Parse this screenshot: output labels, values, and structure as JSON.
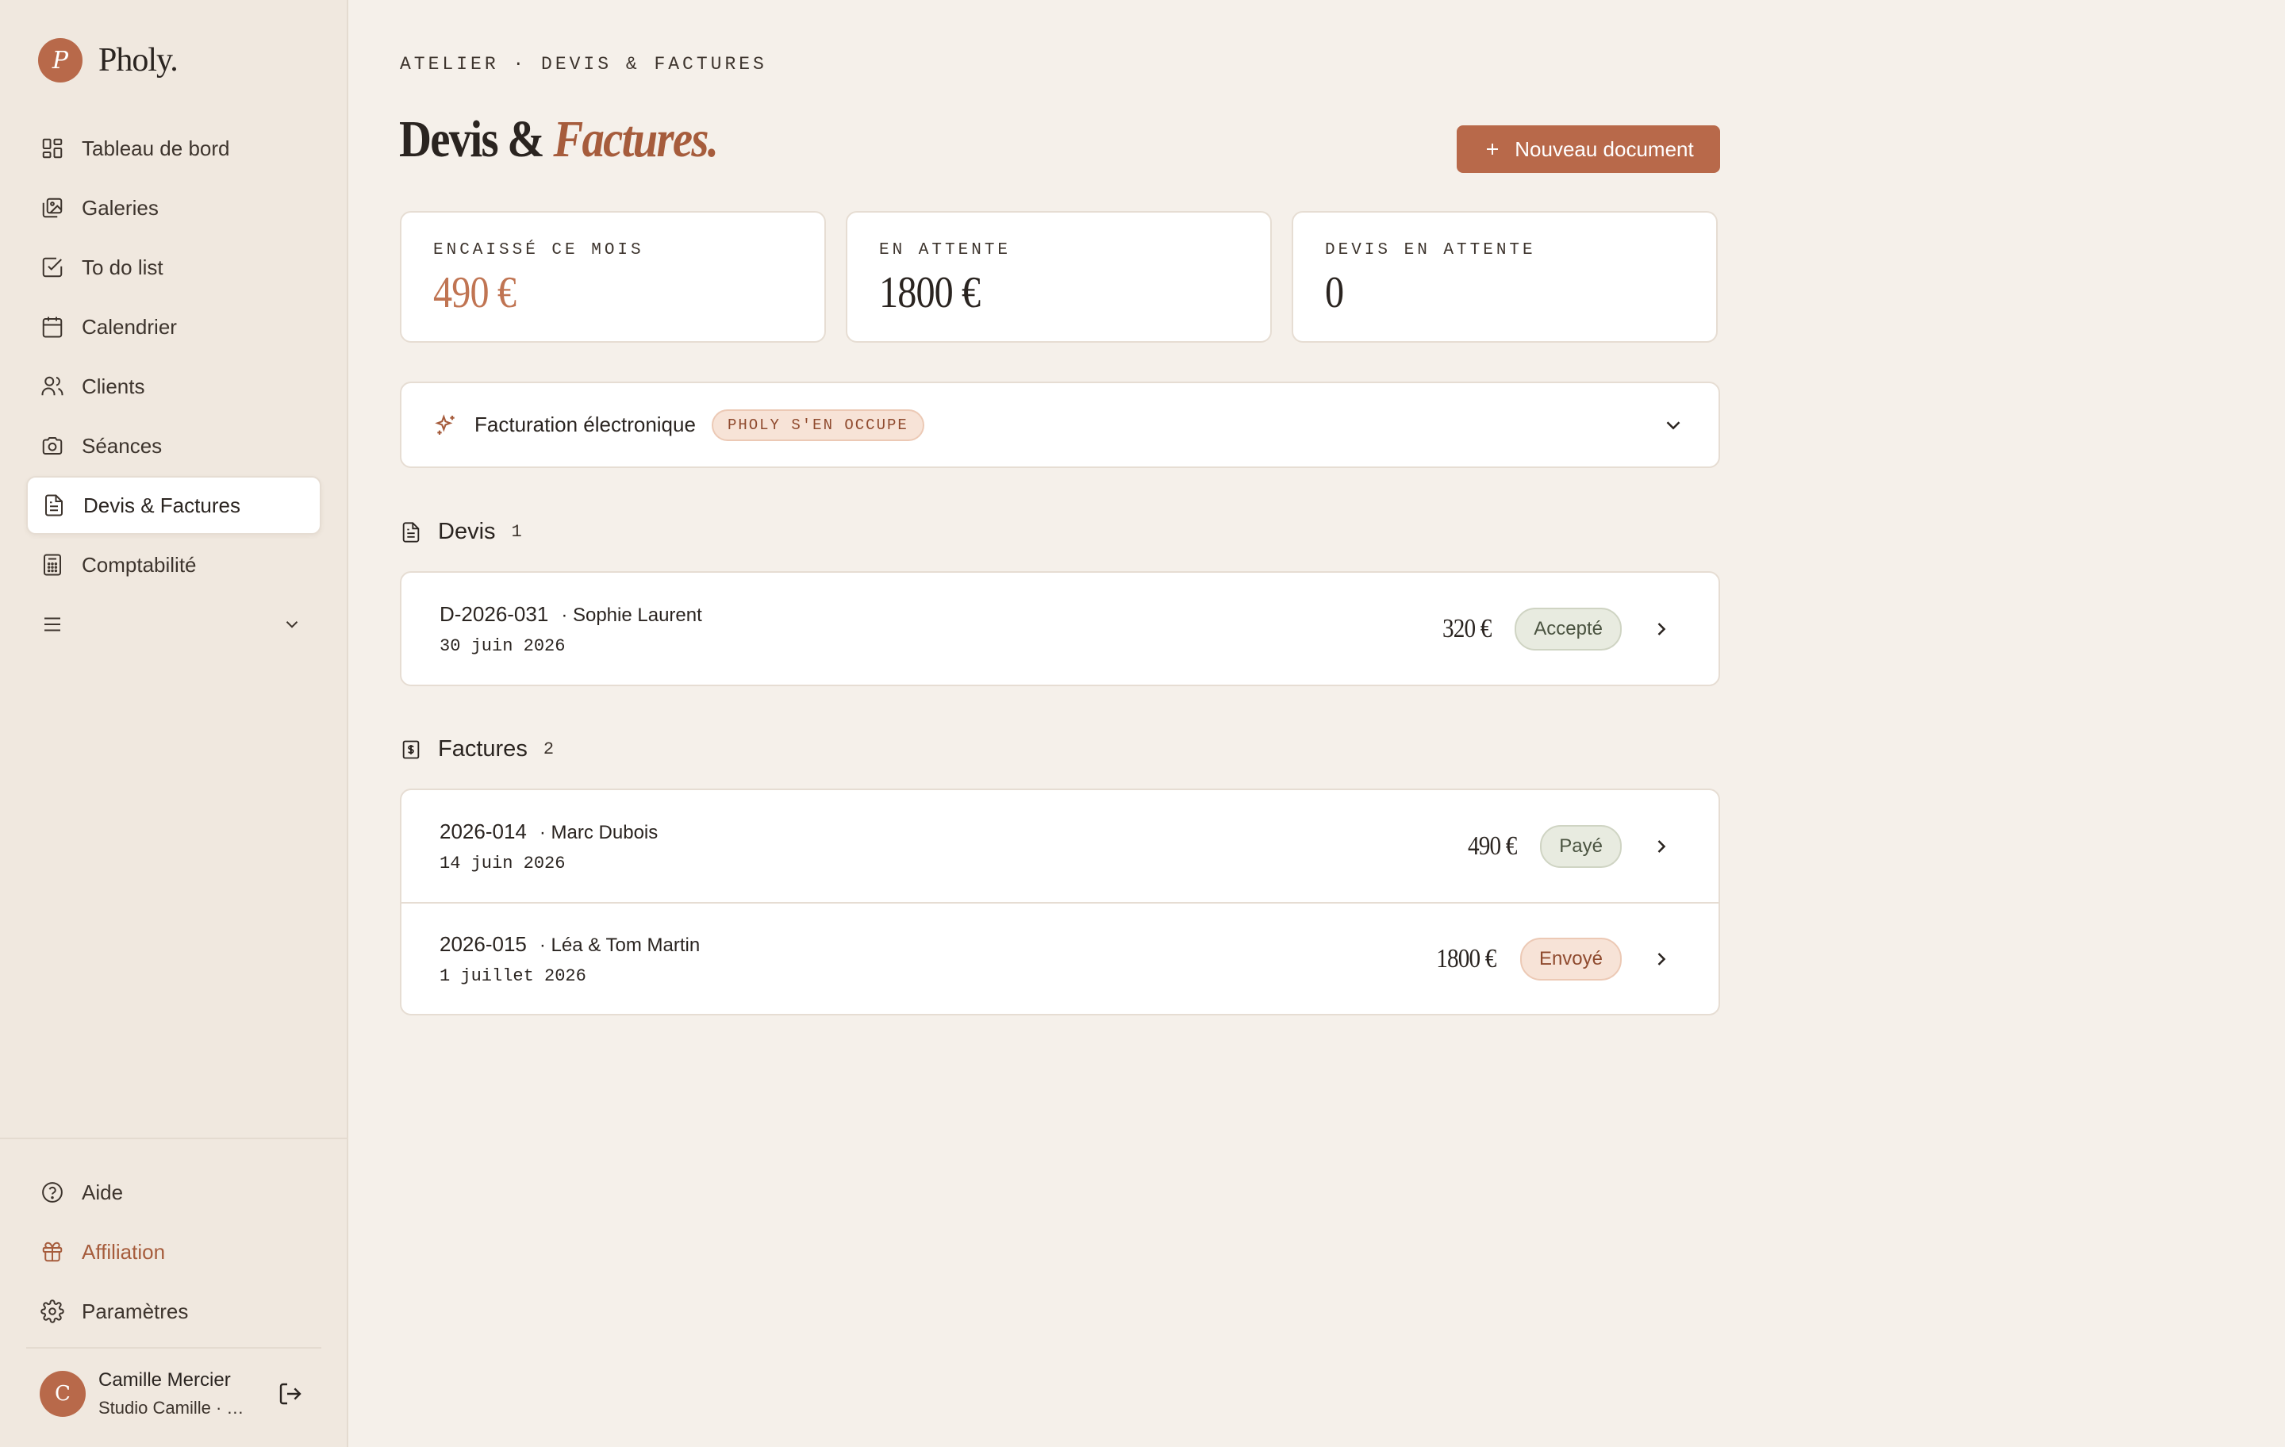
{
  "brand": {
    "mark": "P",
    "name": "Pholy."
  },
  "nav": {
    "items": [
      {
        "label": "Tableau de bord",
        "icon": "dashboard-icon"
      },
      {
        "label": "Galeries",
        "icon": "gallery-icon"
      },
      {
        "label": "To do list",
        "icon": "checkbox-icon"
      },
      {
        "label": "Calendrier",
        "icon": "calendar-icon"
      },
      {
        "label": "Clients",
        "icon": "users-icon"
      },
      {
        "label": "Séances",
        "icon": "camera-icon"
      },
      {
        "label": "Devis & Factures",
        "icon": "document-icon",
        "active": true
      },
      {
        "label": "Comptabilité",
        "icon": "calculator-icon"
      }
    ],
    "more_icon": "menu-icon"
  },
  "bottom_nav": {
    "help": "Aide",
    "affiliation": "Affiliation",
    "settings": "Paramètres"
  },
  "user": {
    "initial": "C",
    "name": "Camille Mercier",
    "studio": "Studio Camille · Photographie"
  },
  "header": {
    "breadcrumb": "ATELIER · DEVIS & FACTURES",
    "title_main": "Devis &",
    "title_accent": "Factures.",
    "new_button": "Nouveau document"
  },
  "stats": [
    {
      "label": "ENCAISSÉ CE MOIS",
      "value": "490 €",
      "accent": true
    },
    {
      "label": "EN ATTENTE",
      "value": "1800 €"
    },
    {
      "label": "DEVIS EN ATTENTE",
      "value": "0"
    }
  ],
  "einvoice": {
    "title": "Facturation électronique",
    "badge": "PHOLY S'EN OCCUPE"
  },
  "quotes": {
    "title": "Devis",
    "count": "1",
    "rows": [
      {
        "number": "D-2026-031",
        "client": "· Sophie Laurent",
        "date": "30 juin 2026",
        "amount": "320 €",
        "status": "Accepté"
      }
    ]
  },
  "invoices": {
    "title": "Factures",
    "count": "2",
    "rows": [
      {
        "number": "2026-014",
        "client": "· Marc Dubois",
        "date": "14 juin 2026",
        "amount": "490 €",
        "status": "Payé"
      },
      {
        "number": "2026-015",
        "client": "· Léa & Tom Martin",
        "date": "1 juillet 2026",
        "amount": "1800 €",
        "status": "Envoyé"
      }
    ]
  },
  "colors": {
    "accent": "#b8694a",
    "background": "#f5f0ea",
    "sidebar": "#f0e8df"
  }
}
